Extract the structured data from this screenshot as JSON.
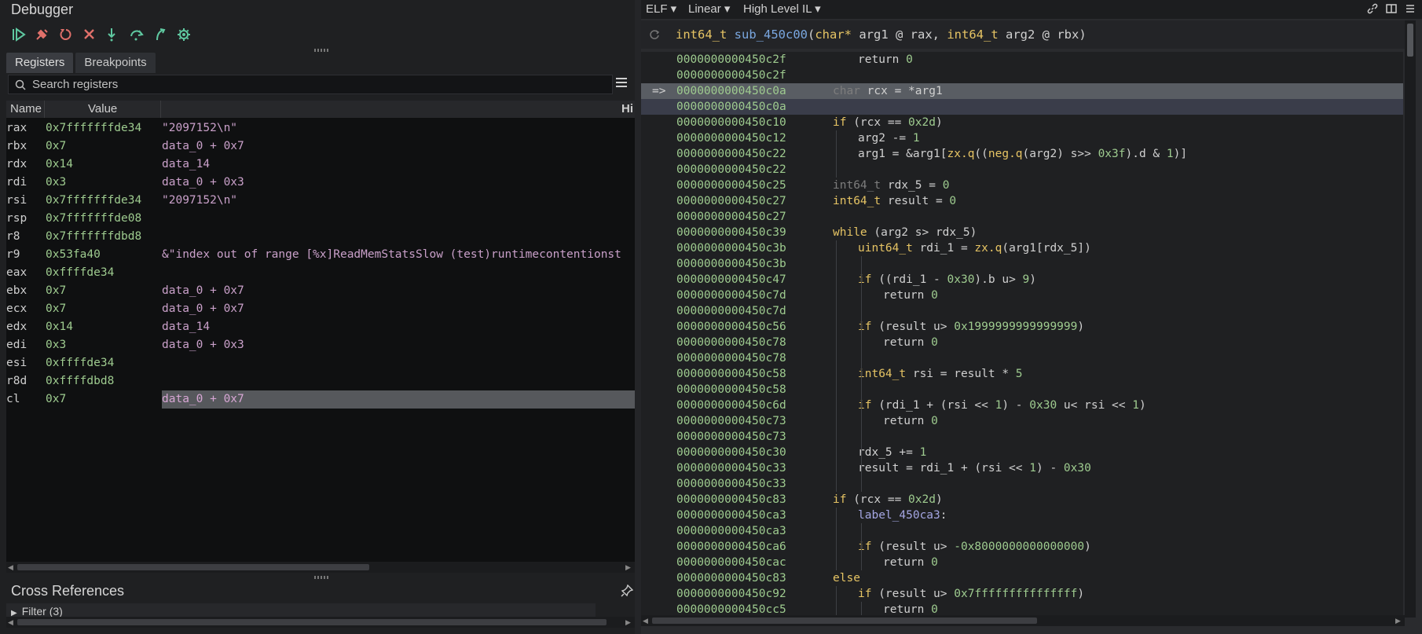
{
  "left": {
    "title": "Debugger",
    "toolbar": [
      "resume-icon",
      "detach-icon",
      "restart-icon",
      "stop-icon",
      "step-into-icon",
      "step-over-icon",
      "step-return-icon",
      "settings-icon"
    ],
    "tabs": [
      {
        "label": "Registers"
      },
      {
        "label": "Breakpoints"
      }
    ],
    "search": {
      "placeholder": "Search registers"
    },
    "columns": {
      "name": "Name",
      "value": "Value",
      "hint": "Hi"
    },
    "registers": [
      {
        "name": "rax",
        "value": "0x7fffffffde34",
        "hint": "\"2097152\\n\""
      },
      {
        "name": "rbx",
        "value": "0x7",
        "hint": "data_0 + 0x7"
      },
      {
        "name": "rdx",
        "value": "0x14",
        "hint": "data_14"
      },
      {
        "name": "rdi",
        "value": "0x3",
        "hint": "data_0 + 0x3"
      },
      {
        "name": "rsi",
        "value": "0x7fffffffde34",
        "hint": "\"2097152\\n\""
      },
      {
        "name": "rsp",
        "value": "0x7fffffffde08",
        "hint": ""
      },
      {
        "name": "r8",
        "value": "0x7fffffffdbd8",
        "hint": ""
      },
      {
        "name": "r9",
        "value": "0x53fa40",
        "hint": "&\"index out of range [%x]ReadMemStatsSlow (test)runtimecontentionst"
      },
      {
        "name": "eax",
        "value": "0xffffde34",
        "hint": ""
      },
      {
        "name": "ebx",
        "value": "0x7",
        "hint": "data_0 + 0x7"
      },
      {
        "name": "ecx",
        "value": "0x7",
        "hint": "data_0 + 0x7"
      },
      {
        "name": "edx",
        "value": "0x14",
        "hint": "data_14"
      },
      {
        "name": "edi",
        "value": "0x3",
        "hint": "data_0 + 0x3"
      },
      {
        "name": "esi",
        "value": "0xffffde34",
        "hint": ""
      },
      {
        "name": "r8d",
        "value": "0xffffdbd8",
        "hint": ""
      },
      {
        "name": "cl",
        "value": "0x7",
        "hint": "data_0 + 0x7"
      }
    ],
    "xref_title": "Cross References",
    "filter_label": "Filter (3)"
  },
  "right": {
    "menus": [
      {
        "label": "ELF ▾"
      },
      {
        "label": "Linear ▾"
      },
      {
        "label": "High Level IL ▾"
      }
    ],
    "signature": {
      "ret": "int64_t",
      "name": "sub_450c00",
      "p1type": "char*",
      "p1": " arg1 @ rax, ",
      "p2type": "int64_t",
      "p2": " arg2 @ rbx)"
    },
    "lines": [
      {
        "addr": "0000000000450c2f",
        "html": "<span style=\"margin-left:32px\">return <span class=num>0</span></span>"
      },
      {
        "addr": "0000000000450c2f",
        "html": ""
      },
      {
        "addr": "0000000000450c0a",
        "html": "<span class=dim>char</span> rcx = *arg1",
        "hl": 1,
        "arrow": "=>"
      },
      {
        "addr": "0000000000450c0a",
        "html": "",
        "hl": 2
      },
      {
        "addr": "0000000000450c10",
        "html": "<span class=typ>if</span> (rcx == <span class=num>0x2d</span>)"
      },
      {
        "addr": "0000000000450c12",
        "html": "<span style=\"margin-left:32px\">arg2 -= <span class=num>1</span></span>"
      },
      {
        "addr": "0000000000450c22",
        "html": "<span style=\"margin-left:32px\">arg1 = &amp;arg1[<span class=typ>zx.q</span>((<span class=typ>neg.q</span>(arg2) s&gt;&gt; <span class=num>0x3f</span>).d &amp; <span class=num>1</span>)]</span>"
      },
      {
        "addr": "0000000000450c22",
        "html": ""
      },
      {
        "addr": "0000000000450c25",
        "html": "<span class=dim>int64_t</span> rdx_5 = <span class=num>0</span>"
      },
      {
        "addr": "0000000000450c27",
        "html": "<span class=typ>int64_t</span> result = <span class=num>0</span>"
      },
      {
        "addr": "0000000000450c27",
        "html": ""
      },
      {
        "addr": "0000000000450c39",
        "html": "<span class=typ>while</span> (arg2 s&gt; rdx_5)"
      },
      {
        "addr": "0000000000450c3b",
        "html": "<span style=\"margin-left:32px\"><span class=typ>uint64_t</span> rdi_1 = <span class=typ>zx.q</span>(arg1[rdx_5])</span>"
      },
      {
        "addr": "0000000000450c3b",
        "html": ""
      },
      {
        "addr": "0000000000450c47",
        "html": "<span style=\"margin-left:32px\"><span class=typ>if</span> ((rdi_1 - <span class=num>0x30</span>).b u&gt; <span class=num>9</span>)</span>"
      },
      {
        "addr": "0000000000450c7d",
        "html": "<span style=\"margin-left:64px\">return <span class=num>0</span></span>"
      },
      {
        "addr": "0000000000450c7d",
        "html": ""
      },
      {
        "addr": "0000000000450c56",
        "html": "<span style=\"margin-left:32px\"><span class=typ>if</span> (result u&gt; <span class=num>0x1999999999999999</span>)</span>"
      },
      {
        "addr": "0000000000450c78",
        "html": "<span style=\"margin-left:64px\">return <span class=num>0</span></span>"
      },
      {
        "addr": "0000000000450c78",
        "html": ""
      },
      {
        "addr": "0000000000450c58",
        "html": "<span style=\"margin-left:32px\"><span class=typ>int64_t</span> rsi = result * <span class=num>5</span></span>"
      },
      {
        "addr": "0000000000450c58",
        "html": ""
      },
      {
        "addr": "0000000000450c6d",
        "html": "<span style=\"margin-left:32px\"><span class=typ>if</span> (rdi_1 + (rsi &lt;&lt; <span class=num>1</span>) - <span class=num>0x30</span> u&lt; rsi &lt;&lt; <span class=num>1</span>)</span>"
      },
      {
        "addr": "0000000000450c73",
        "html": "<span style=\"margin-left:64px\">return <span class=num>0</span></span>"
      },
      {
        "addr": "0000000000450c73",
        "html": ""
      },
      {
        "addr": "0000000000450c30",
        "html": "<span style=\"margin-left:32px\">rdx_5 += <span class=num>1</span></span>"
      },
      {
        "addr": "0000000000450c33",
        "html": "<span style=\"margin-left:32px\">result = rdi_1 + (rsi &lt;&lt; <span class=num>1</span>) - <span class=num>0x30</span></span>"
      },
      {
        "addr": "0000000000450c33",
        "html": ""
      },
      {
        "addr": "0000000000450c83",
        "html": "<span class=typ>if</span> (rcx == <span class=num>0x2d</span>)"
      },
      {
        "addr": "0000000000450ca3",
        "html": "<span style=\"margin-left:32px\"><span class=lbl>label_450ca3</span>:</span>"
      },
      {
        "addr": "0000000000450ca3",
        "html": ""
      },
      {
        "addr": "0000000000450ca6",
        "html": "<span style=\"margin-left:32px\"><span class=typ>if</span> (result u&gt; <span class=num>-0x8000000000000000</span>)</span>"
      },
      {
        "addr": "0000000000450cac",
        "html": "<span style=\"margin-left:64px\">return <span class=num>0</span></span>"
      },
      {
        "addr": "0000000000450c83",
        "html": "<span class=typ>else</span>"
      },
      {
        "addr": "0000000000450c92",
        "html": "<span style=\"margin-left:32px\"><span class=typ>if</span> (result u&gt; <span class=num>0x7fffffffffffffff</span>)</span>"
      },
      {
        "addr": "0000000000450cc5",
        "html": "<span style=\"margin-left:64px\">return <span class=num>0</span></span>"
      }
    ]
  }
}
